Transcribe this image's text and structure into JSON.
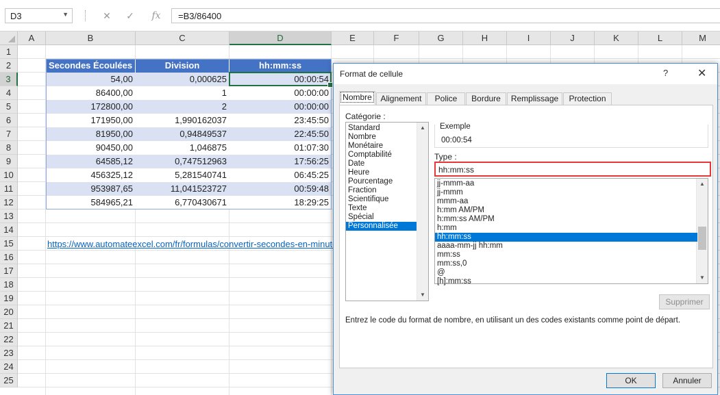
{
  "formula_bar": {
    "name_box": "D3",
    "cancel_glyph": "✕",
    "enter_glyph": "✓",
    "fx_glyph": "fx",
    "formula": "=B3/86400"
  },
  "columns": [
    "A",
    "B",
    "C",
    "D",
    "E",
    "F",
    "G",
    "H",
    "I",
    "J",
    "K",
    "L",
    "M"
  ],
  "rows": [
    "1",
    "2",
    "3",
    "4",
    "5",
    "6",
    "7",
    "8",
    "9",
    "10",
    "11",
    "12",
    "13",
    "14",
    "15",
    "16",
    "17",
    "18",
    "19",
    "20",
    "21",
    "22",
    "23",
    "24",
    "25"
  ],
  "selected_cell": {
    "column": "D",
    "row": "3"
  },
  "table": {
    "headers": [
      "Secondes Écoulées",
      "Division",
      "hh:mm:ss"
    ],
    "rows": [
      [
        "54,00",
        "0,000625",
        "00:00:54"
      ],
      [
        "86400,00",
        "1",
        "00:00:00"
      ],
      [
        "172800,00",
        "2",
        "00:00:00"
      ],
      [
        "171950,00",
        "1,990162037",
        "23:45:50"
      ],
      [
        "81950,00",
        "0,94849537",
        "22:45:50"
      ],
      [
        "90450,00",
        "1,046875",
        "01:07:30"
      ],
      [
        "64585,12",
        "0,747512963",
        "17:56:25"
      ],
      [
        "456325,12",
        "5,281540741",
        "06:45:25"
      ],
      [
        "953987,65",
        "11,041523727",
        "00:59:48"
      ],
      [
        "584965,21",
        "6,770430671",
        "18:29:25"
      ]
    ]
  },
  "link_text": "https://www.automateexcel.com/fr/formulas/convertir-secondes-en-minutes-heures-temps/",
  "dialog": {
    "title": "Format de cellule",
    "help_glyph": "?",
    "close_glyph": "✕",
    "tabs": [
      "Nombre",
      "Alignement",
      "Police",
      "Bordure",
      "Remplissage",
      "Protection"
    ],
    "active_tab": "Nombre",
    "category_label": "Catégorie :",
    "categories": [
      "Standard",
      "Nombre",
      "Monétaire",
      "Comptabilité",
      "Date",
      "Heure",
      "Pourcentage",
      "Fraction",
      "Scientifique",
      "Texte",
      "Spécial",
      "Personnalisée"
    ],
    "selected_category": "Personnalisée",
    "example_label": "Exemple",
    "example_value": "00:00:54",
    "type_label": "Type :",
    "type_value": "hh:mm:ss",
    "type_list": [
      "jj-mmm-aa",
      "jj-mmm",
      "mmm-aa",
      "h:mm AM/PM",
      "h:mm:ss AM/PM",
      "h:mm",
      "hh:mm:ss",
      "aaaa-mm-jj hh:mm",
      "mm:ss",
      "mm:ss,0",
      "@",
      "[h]:mm:ss"
    ],
    "selected_type": "hh:mm:ss",
    "delete_button": "Supprimer",
    "description": "Entrez le code du format de nombre, en utilisant un des codes existants comme point de départ.",
    "ok_button": "OK",
    "cancel_button": "Annuler"
  }
}
